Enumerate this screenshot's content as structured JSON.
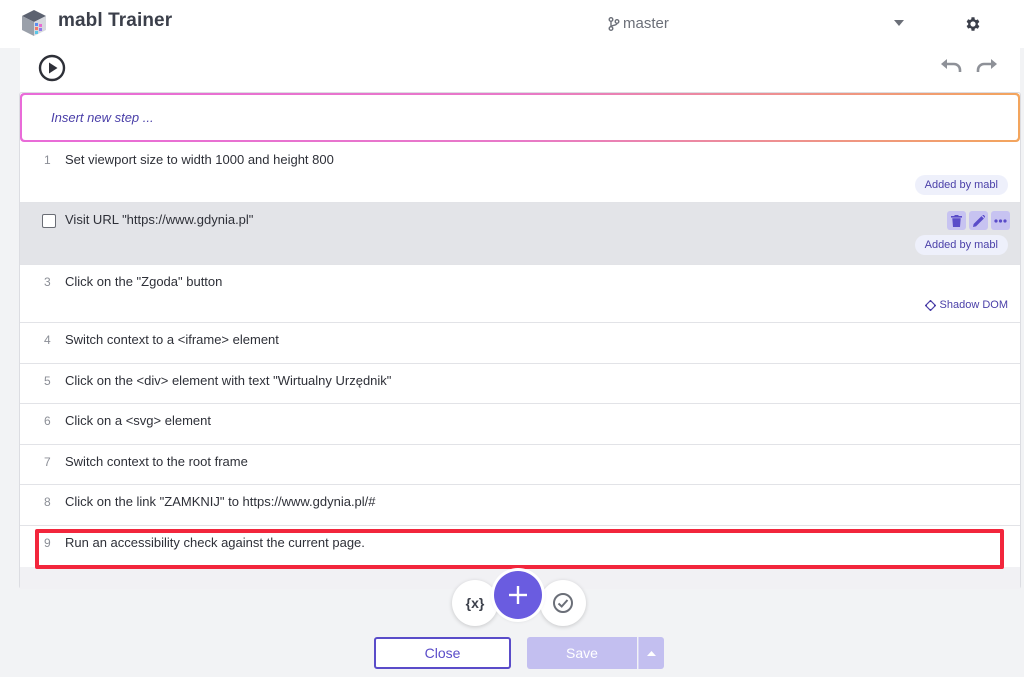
{
  "header": {
    "app_title": "mabl Trainer",
    "branch": "master"
  },
  "insert": {
    "placeholder": "Insert new step ..."
  },
  "steps": [
    {
      "num": "1",
      "text": "Set viewport size to width 1000 and height 800",
      "tag": "Added by mabl"
    },
    {
      "num": "",
      "text": "Visit URL \"https://www.gdynia.pl\"",
      "tag": "Added by mabl"
    },
    {
      "num": "3",
      "text": "Click on the \"Zgoda\" button",
      "tag": "Shadow DOM"
    },
    {
      "num": "4",
      "text": "Switch context to a <iframe> element"
    },
    {
      "num": "5",
      "text": "Click on the <div> element with text \"Wirtualny Urzędnik\""
    },
    {
      "num": "6",
      "text": "Click on a <svg> element"
    },
    {
      "num": "7",
      "text": "Switch context to the root frame"
    },
    {
      "num": "8",
      "text": "Click on the link \"ZAMKNIJ\" to https://www.gdynia.pl/#"
    },
    {
      "num": "9",
      "text": "Run an accessibility check against the current page."
    }
  ],
  "fab": {
    "variables_label": "{x}"
  },
  "buttons": {
    "close": "Close",
    "save": "Save"
  },
  "colors": {
    "accent": "#6a5ce0",
    "highlight": "#f2263c",
    "tag_text": "#4a3fa8"
  }
}
